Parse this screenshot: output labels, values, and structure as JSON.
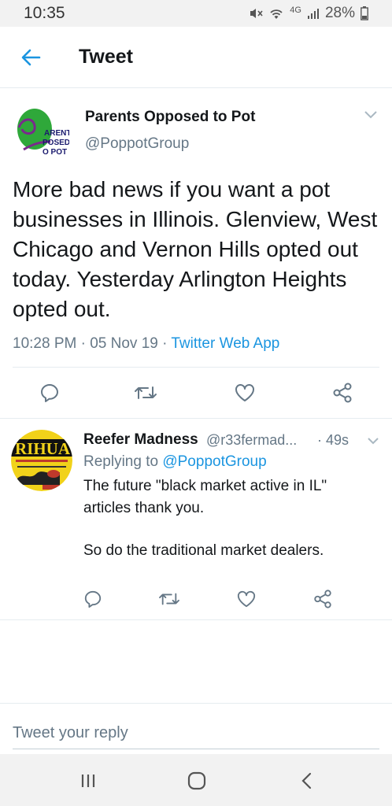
{
  "status_bar": {
    "time": "10:35",
    "network": "4G",
    "battery": "28%"
  },
  "header": {
    "title": "Tweet"
  },
  "tweet": {
    "author_name": "Parents Opposed to Pot",
    "author_handle": "@PoppotGroup",
    "avatar_text": [
      "ARENTS",
      "POSED",
      "O POT"
    ],
    "text": "More bad news if you want a pot businesses in Illinois.  Glenview, West Chicago and Vernon Hills opted out today. Yesterday Arlington Heights opted out.",
    "timestamp": "10:28 PM · 05 Nov 19 · ",
    "source": "Twitter Web App"
  },
  "reply": {
    "author_name": "Reefer Madness",
    "author_handle": "@r33fermad...",
    "time": "· 49s",
    "replying_prefix": "Replying to ",
    "replying_to": "@PoppotGroup",
    "avatar_text": "RIHUA",
    "text_line1": "The future \"black market active in IL\" articles thank you.",
    "text_line2": "So do the traditional market dealers."
  },
  "compose": {
    "placeholder": "Tweet your reply"
  },
  "colors": {
    "accent": "#1b95e0",
    "secondary_text": "#657786",
    "icon": "#657786"
  }
}
